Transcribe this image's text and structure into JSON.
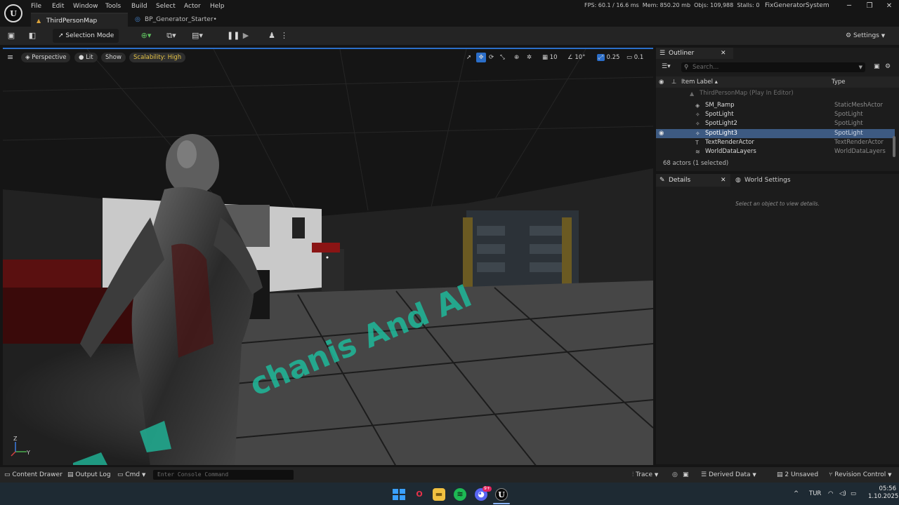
{
  "app": {
    "logo_text": "U",
    "project": "FixGeneratorSystem"
  },
  "menu": [
    "File",
    "Edit",
    "Window",
    "Tools",
    "Build",
    "Select",
    "Actor",
    "Help"
  ],
  "tabs": [
    {
      "label": "ThirdPersonMap"
    },
    {
      "label": "BP_Generator_Starter•"
    }
  ],
  "stats": {
    "fps_label": "FPS:",
    "fps": "60.1",
    "ms": "/ 16.6 ms",
    "mem_label": "Mem:",
    "mem": "850.20 mb",
    "objs_label": "Objs:",
    "objs": "109,988",
    "stalls_label": "Stalls:",
    "stalls": "0"
  },
  "toolbar": {
    "selection_mode": "Selection Mode",
    "settings": "Settings"
  },
  "viewport": {
    "perspective": "Perspective",
    "lit": "Lit",
    "show": "Show",
    "scalability": "Scalability: High",
    "grid_snap": "10",
    "rot_snap": "10°",
    "scale_snap": "0.25",
    "cam_speed": "0.1",
    "floor_text": "chanis And AI",
    "axis_z": "Z",
    "axis_y": "Y"
  },
  "outliner": {
    "title": "Outliner",
    "search_placeholder": "Search...",
    "col_label": "Item Label ▴",
    "col_type": "Type",
    "map_row": "ThirdPersonMap (Play In Editor)",
    "rows": [
      {
        "label": "SM_Ramp",
        "type": "StaticMeshActor"
      },
      {
        "label": "SpotLight",
        "type": "SpotLight"
      },
      {
        "label": "SpotLight2",
        "type": "SpotLight"
      },
      {
        "label": "SpotLight3",
        "type": "SpotLight"
      },
      {
        "label": "TextRenderActor",
        "type": "TextRenderActor"
      },
      {
        "label": "WorldDataLayers",
        "type": "WorldDataLayers"
      }
    ],
    "count": "68 actors (1 selected)"
  },
  "details": {
    "title": "Details",
    "world_settings": "World Settings",
    "empty": "Select an object to view details."
  },
  "bottom": {
    "content_drawer": "Content Drawer",
    "output_log": "Output Log",
    "cmd": "Cmd",
    "console_placeholder": "Enter Console Command",
    "trace": "Trace",
    "derived_data": "Derived Data",
    "unsaved": "2 Unsaved",
    "revision": "Revision Control"
  },
  "taskbar": {
    "lang": "TUR",
    "time": "05:56",
    "date": "1.10.2025",
    "badge": "9+"
  },
  "colors": {
    "accent": "#2b6ec9",
    "selected_row": "#3d5a82",
    "scalability": "#e6c446",
    "floor_text": "#1fb89a"
  }
}
